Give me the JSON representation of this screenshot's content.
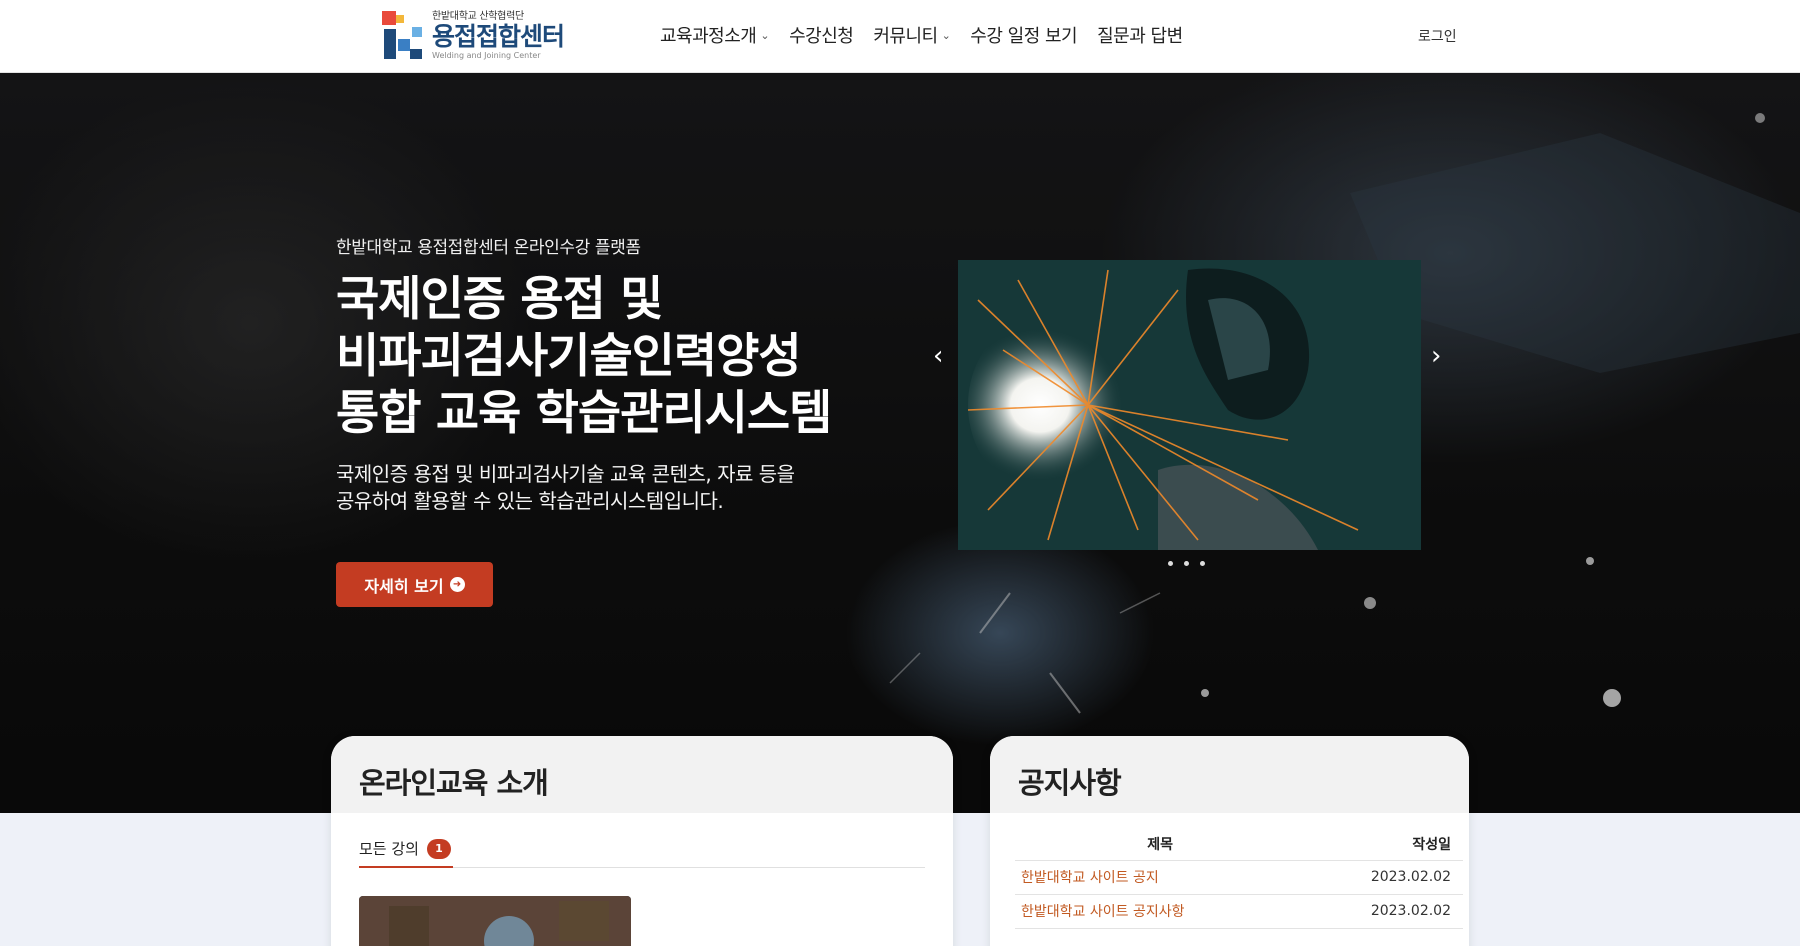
{
  "header": {
    "logo": {
      "sub": "한밭대학교 산학협력단",
      "main": "용접접합센터",
      "en": "Welding and Joining Center"
    },
    "nav": [
      {
        "label": "교육과정소개",
        "has_dropdown": true
      },
      {
        "label": "수강신청",
        "has_dropdown": false
      },
      {
        "label": "커뮤니티",
        "has_dropdown": true
      },
      {
        "label": "수강 일정 보기",
        "has_dropdown": false
      },
      {
        "label": "질문과 답변",
        "has_dropdown": false
      }
    ],
    "login_label": "로그인"
  },
  "hero": {
    "subtitle": "한밭대학교 용접접합센터 온라인수강 플랫폼",
    "title_lines": [
      "국제인증 용접 및",
      "비파괴검사기술인력양성",
      "통합 교육 학습관리시스템"
    ],
    "desc_lines": [
      "국제인증 용접 및 비파괴검사기술 교육 콘텐츠, 자료 등을",
      "공유하여 활용할 수 있는 학습관리시스템입니다."
    ],
    "button_label": "자세히 보기",
    "carousel": {
      "dot_count": 3,
      "active": 0
    }
  },
  "online_edu": {
    "title": "온라인교육 소개",
    "tab_label": "모든 강의",
    "tab_count": "1"
  },
  "notice": {
    "title": "공지사항",
    "columns": [
      "제목",
      "작성일"
    ],
    "rows": [
      {
        "title": "한밭대학교 사이트 공지",
        "date": "2023.02.02"
      },
      {
        "title": "한밭대학교 사이트 공지사항",
        "date": "2023.02.02"
      }
    ]
  },
  "colors": {
    "accent": "#c43c22",
    "notice_link": "#c25a22",
    "logo_blue": "#1e4a7a"
  }
}
